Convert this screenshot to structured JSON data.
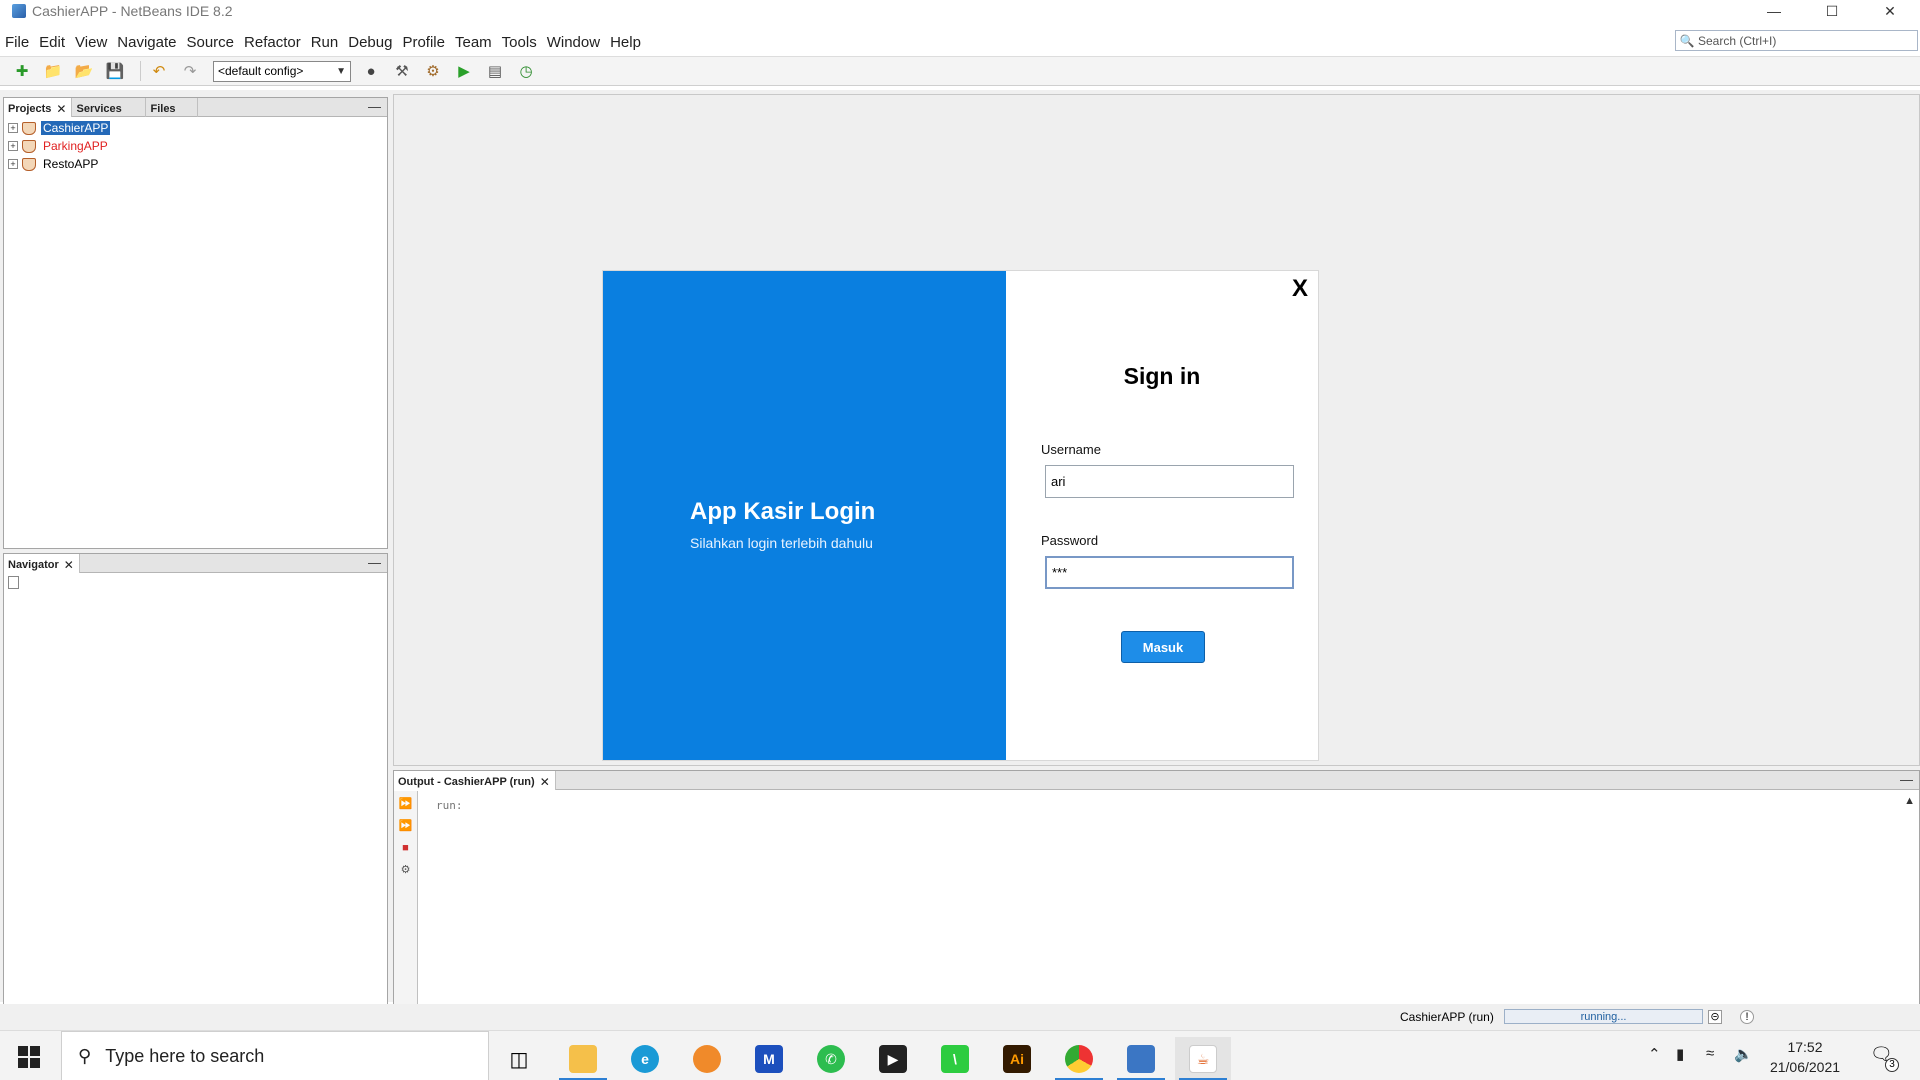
{
  "window": {
    "title": "CashierAPP - NetBeans IDE 8.2"
  },
  "menu": [
    "File",
    "Edit",
    "View",
    "Navigate",
    "Source",
    "Refactor",
    "Run",
    "Debug",
    "Profile",
    "Team",
    "Tools",
    "Window",
    "Help"
  ],
  "search": {
    "placeholder": "Search (Ctrl+I)"
  },
  "toolbar": {
    "config": "<default config>"
  },
  "projects_panel": {
    "tabs": [
      "Projects",
      "Services",
      "Files"
    ],
    "items": [
      {
        "label": "CashierAPP",
        "state": "selected"
      },
      {
        "label": "ParkingAPP",
        "state": "error"
      },
      {
        "label": "RestoAPP",
        "state": "normal"
      }
    ]
  },
  "navigator_panel": {
    "tab": "Navigator"
  },
  "login": {
    "heading": "App Kasir Login",
    "subheading": "Silahkan login terlebih dahulu",
    "close": "X",
    "title": "Sign in",
    "username_label": "Username",
    "username_value": "ari",
    "password_label": "Password",
    "password_value": "***",
    "submit": "Masuk"
  },
  "output": {
    "tab": "Output - CashierAPP (run)",
    "text": "run:"
  },
  "status": {
    "task": "CashierAPP (run)",
    "progress_text": "running...",
    "progress_fraction": 0.0
  },
  "taskbar": {
    "search_placeholder": "Type here to search",
    "time": "17:52",
    "date": "21/06/2021",
    "notification_count": "3"
  }
}
